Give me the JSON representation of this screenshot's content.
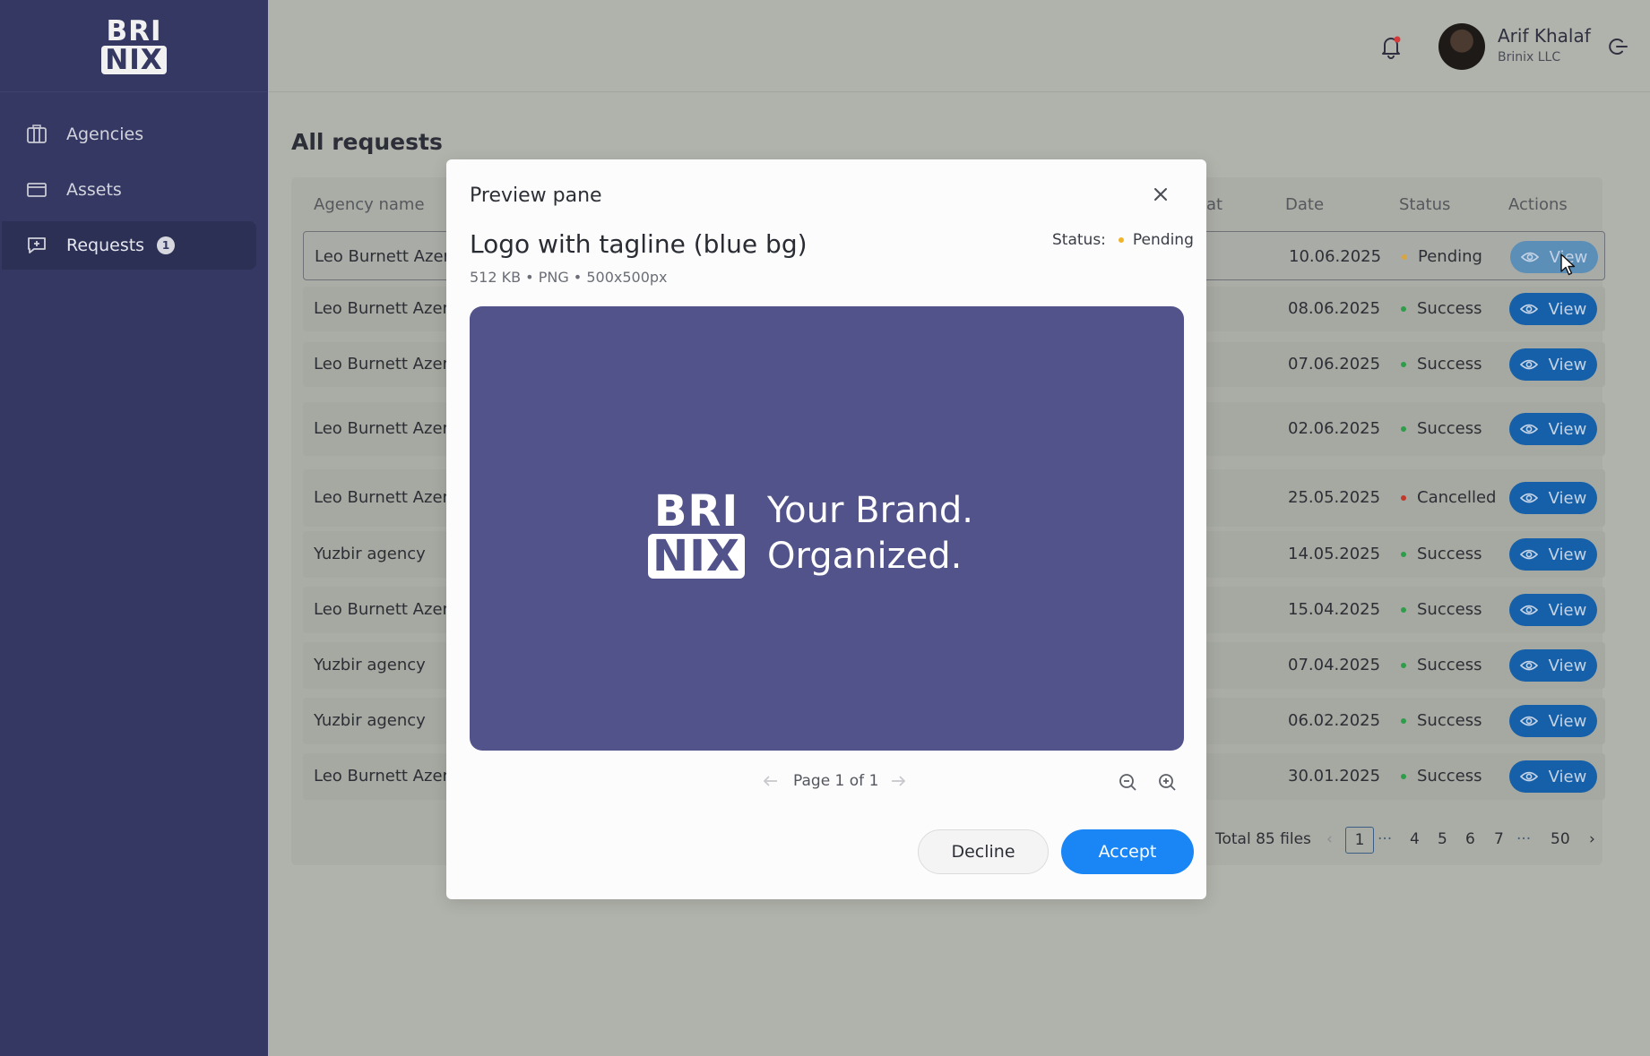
{
  "brand": {
    "line1": "BRI",
    "line2": "NIX"
  },
  "sidebar": {
    "items": [
      {
        "label": "Agencies",
        "icon": "building-icon"
      },
      {
        "label": "Assets",
        "icon": "folder-icon"
      },
      {
        "label": "Requests",
        "icon": "message-icon",
        "badge": "1",
        "active": true
      }
    ]
  },
  "header": {
    "user_name": "Arif Khalaf",
    "user_company": "Brinix LLC"
  },
  "main": {
    "title": "All requests",
    "columns": {
      "agency": "Agency name",
      "format_partial": "at",
      "date": "Date",
      "status": "Status",
      "actions": "Actions"
    },
    "view_label": "View",
    "rows": [
      {
        "agency": "Leo Burnett Azerl",
        "date": "10.06.2025",
        "status": "Pending",
        "status_color": "#d9a441"
      },
      {
        "agency": "Leo Burnett Azerl",
        "date": "08.06.2025",
        "status": "Success",
        "status_color": "#2e9d4a"
      },
      {
        "agency": "Leo Burnett Azerl",
        "date": "07.06.2025",
        "status": "Success",
        "status_color": "#2e9d4a"
      },
      {
        "agency": "Leo Burnett Azerl",
        "date": "02.06.2025",
        "status": "Success",
        "status_color": "#2e9d4a"
      },
      {
        "agency": "Leo Burnett Azerl",
        "date": "25.05.2025",
        "status": "Cancelled",
        "status_color": "#c0392b"
      },
      {
        "agency": "Yuzbir agency",
        "date": "14.05.2025",
        "status": "Success",
        "status_color": "#2e9d4a"
      },
      {
        "agency": "Leo Burnett Azerl",
        "date": "15.04.2025",
        "status": "Success",
        "status_color": "#2e9d4a"
      },
      {
        "agency": "Yuzbir agency",
        "date": "07.04.2025",
        "status": "Success",
        "status_color": "#2e9d4a"
      },
      {
        "agency": "Yuzbir agency",
        "date": "06.02.2025",
        "status": "Success",
        "status_color": "#2e9d4a"
      },
      {
        "agency": "Leo Burnett Azerl",
        "date": "30.01.2025",
        "status": "Success",
        "status_color": "#2e9d4a"
      }
    ],
    "pagination": {
      "total": "Total 85 files",
      "current": "1",
      "pages": [
        "4",
        "5",
        "6",
        "7"
      ],
      "last": "50",
      "ellipsis": "···"
    }
  },
  "modal": {
    "title": "Preview pane",
    "file_title": "Logo with tagline (blue bg)",
    "file_meta": "512 KB  •  PNG  •  500x500px",
    "status_label": "Status:",
    "status_value": "Pending",
    "status_color": "#f0b429",
    "preview": {
      "logo_line1": "BRI",
      "logo_line2": "NIX",
      "tagline_line1": "Your Brand.",
      "tagline_line2": "Organized.",
      "bg_color": "#52538a"
    },
    "page_label": "Page 1 of 1",
    "decline_label": "Decline",
    "accept_label": "Accept",
    "accent_color": "#1a86f5"
  }
}
